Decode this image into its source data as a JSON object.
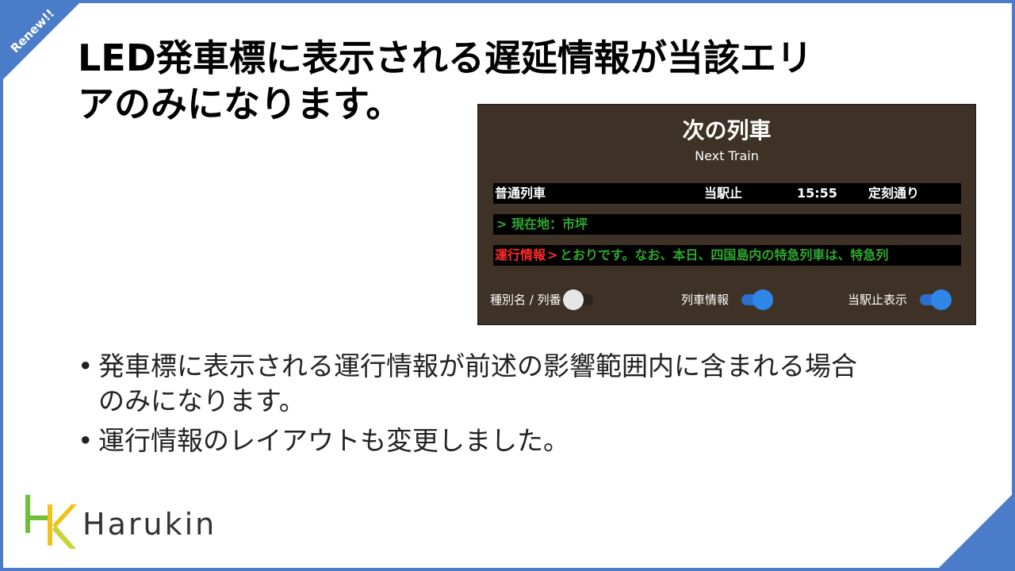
{
  "badge": "Renew!!",
  "title_lines": [
    "LED発車標に表示される遅延情報が当該エリ",
    "アのみになります。"
  ],
  "board": {
    "title": "次の列車",
    "subtitle": "Next Train",
    "row1": {
      "type": "普通列車",
      "stop": "当駅止",
      "time": "15:55",
      "status": "定刻通り"
    },
    "row2": {
      "text": "> 現在地：市坪"
    },
    "row3": {
      "label": "運行情報",
      "arrow": ">",
      "text": "とおりです。なお、本日、四国島内の特急列車は、特急列"
    },
    "toggles": [
      {
        "label": "種別名 / 列番",
        "state": "off"
      },
      {
        "label": "列車情報",
        "state": "on"
      },
      {
        "label": "当駅止表示",
        "state": "on"
      }
    ]
  },
  "bullets": [
    {
      "marker": "•",
      "lines": [
        "発車標に表示される運行情報が前述の影響範囲内に含まれる場合",
        "のみになります。"
      ]
    },
    {
      "marker": "•",
      "lines": [
        "運行情報のレイアウトも変更しました。"
      ]
    }
  ],
  "logo": {
    "text": "Harukin"
  },
  "colors": {
    "accent": "#4a7cc9",
    "board_bg": "#3e3226",
    "led_green": "#2fa82f",
    "led_red": "#ff2a2a",
    "toggle_on": "#2f86e6"
  }
}
